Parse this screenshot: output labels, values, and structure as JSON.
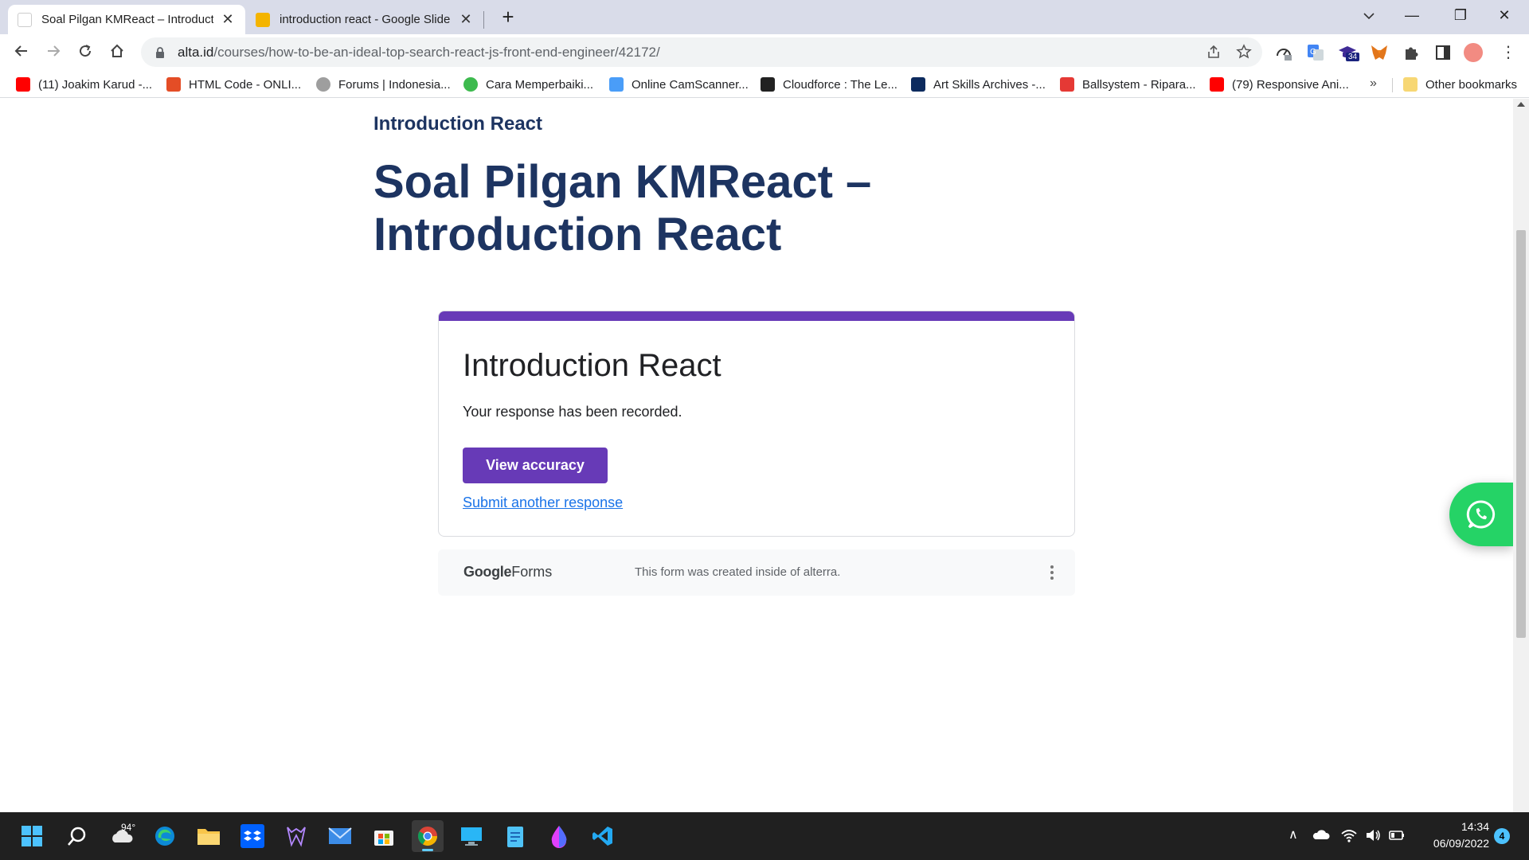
{
  "browser": {
    "tabs": [
      {
        "title": "Soal Pilgan KMReact – Introducti",
        "active": true
      },
      {
        "title": "introduction react - Google Slide",
        "active": false
      }
    ],
    "new_tab": "+",
    "controls": {
      "tab_search": "⌵",
      "minimize": "—",
      "maximize": "❐",
      "close": "✕"
    },
    "url_host": "alta.id",
    "url_path": "/courses/how-to-be-an-ideal-top-search-react-js-front-end-engineer/42172/",
    "menu": "⋮"
  },
  "extensions": {
    "grad_badge": "34"
  },
  "bookmarks": {
    "items": [
      {
        "label": "(11) Joakim Karud -...",
        "icon_color": "#ff0000"
      },
      {
        "label": "HTML Code - ONLI...",
        "icon_color": "#e44d26"
      },
      {
        "label": "Forums | Indonesia...",
        "icon_color": "#9e9e9e"
      },
      {
        "label": "Cara Memperbaiki...",
        "icon_color": "#3dba4e"
      },
      {
        "label": "Online CamScanner...",
        "icon_color": "#4a9df8"
      },
      {
        "label": "Cloudforce : The Le...",
        "icon_color": "#222222"
      },
      {
        "label": "Art Skills Archives -...",
        "icon_color": "#0d2b5e"
      },
      {
        "label": "Ballsystem - Ripara...",
        "icon_color": "#e53935"
      },
      {
        "label": "(79) Responsive Ani...",
        "icon_color": "#ff0000"
      }
    ],
    "overflow": "»",
    "other": "Other bookmarks"
  },
  "page": {
    "breadcrumb": "Introduction React",
    "title": "Soal Pilgan KMReact – Introduction React"
  },
  "form": {
    "accent_color": "#673ab7",
    "title": "Introduction React",
    "message": "Your response has been recorded.",
    "view_accuracy": "View accuracy",
    "submit_another": "Submit another response",
    "footer_logo_google": "Google",
    "footer_logo_forms": "Forms",
    "footer_text": "This form was created inside of alterra."
  },
  "taskbar": {
    "weather_temp": "94°",
    "tray_chevron": "∧",
    "time": "14:34",
    "date": "06/09/2022",
    "notifications": "4"
  }
}
